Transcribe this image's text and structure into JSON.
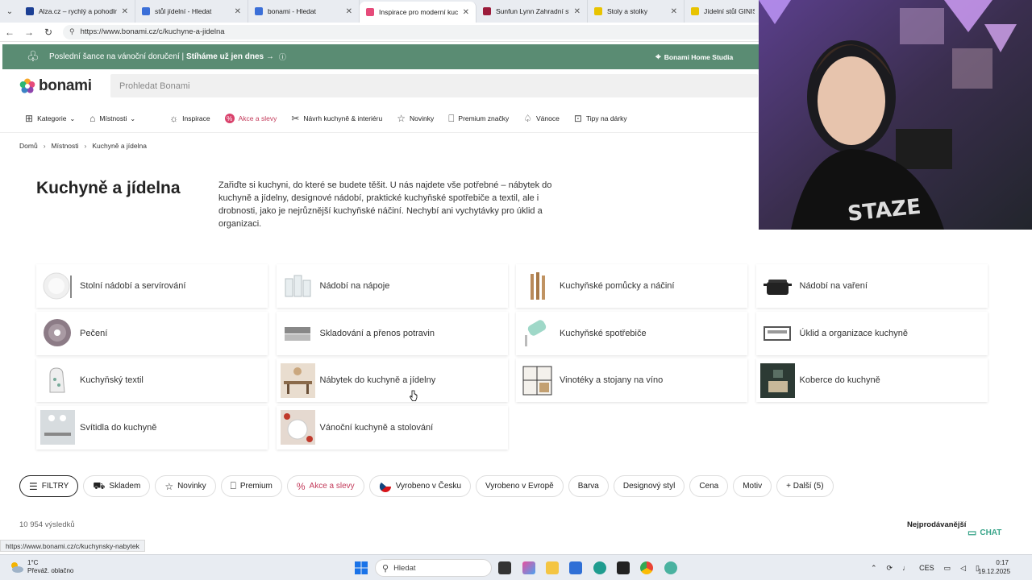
{
  "browser": {
    "tabs": [
      {
        "title": "Alza.cz – rychlý a pohodlný ná",
        "icon": "alza-favicon",
        "color": "#1c3f94"
      },
      {
        "title": "stůl jídelní - Hledat",
        "icon": "search-favicon",
        "color": "#3b6fd8"
      },
      {
        "title": "bonami - Hledat",
        "icon": "search-favicon",
        "color": "#3b6fd8"
      },
      {
        "title": "Inspirace pro moderní kuchy",
        "icon": "bonami-favicon",
        "color": "#e64b7a"
      },
      {
        "title": "Sunfun Lynn Zahradní stůl | B",
        "icon": "sunfun-favicon",
        "color": "#9b1b3a"
      },
      {
        "title": "Stoly a stolky",
        "icon": "sconto-favicon",
        "color": "#e8c300"
      },
      {
        "title": "Jídelní stůl GINISA",
        "icon": "sconto-favicon",
        "color": "#e8c300"
      }
    ],
    "active_tab": 3,
    "url": "https://www.bonami.cz/c/kuchyne-a-jidelna",
    "status_url": "https://www.bonami.cz/c/kuchynsky-nabytek"
  },
  "banner": {
    "text": "Poslední šance na vánoční doručení | ",
    "bold": "Stíháme už jen dnes →",
    "studio": "Bonami Home Studia"
  },
  "header": {
    "logo": "bonami",
    "search_placeholder": "Prohledat Bonami"
  },
  "menu": [
    {
      "label": "Kategorie",
      "icon": "grid-icon",
      "dropdown": true
    },
    {
      "label": "Místnosti",
      "icon": "house-icon",
      "dropdown": true
    },
    {
      "label": "Inspirace",
      "icon": "bulb-icon"
    },
    {
      "label": "Akce a slevy",
      "icon": "percent-icon",
      "sale": true
    },
    {
      "label": "Návrh kuchyně & interiéru",
      "icon": "tools-icon"
    },
    {
      "label": "Novinky",
      "icon": "star-icon"
    },
    {
      "label": "Premium značky",
      "icon": "bookmark-icon"
    },
    {
      "label": "Vánoce",
      "icon": "bell-icon"
    },
    {
      "label": "Tipy na dárky",
      "icon": "gift-icon"
    }
  ],
  "breadcrumb": [
    "Domů",
    "Místnosti",
    "Kuchyně a jídelna"
  ],
  "page": {
    "title": "Kuchyně a jídelna",
    "intro": "Zařiďte si kuchyni, do které se budete těšit. U nás najdete vše potřebné – nábytek do kuchyně a jídelny, designové nádobí, praktické kuchyňské spotřebiče a textil, ale i drobnosti, jako je nejrůznější kuchyňské náčiní. Nechybí ani vychytávky pro úklid a organizaci."
  },
  "categories": [
    {
      "label": "Stolní nádobí a servírování",
      "thumb": "plate"
    },
    {
      "label": "Nádobí na nápoje",
      "thumb": "glasses"
    },
    {
      "label": "Kuchyňské pomůcky a náčiní",
      "thumb": "utensils"
    },
    {
      "label": "Nádobí na vaření",
      "thumb": "pot"
    },
    {
      "label": "Pečení",
      "thumb": "bundt"
    },
    {
      "label": "Skladování a přenos potravin",
      "thumb": "container"
    },
    {
      "label": "Kuchyňské spotřebiče",
      "thumb": "mixer"
    },
    {
      "label": "Úklid a organizace kuchyně",
      "thumb": "rack"
    },
    {
      "label": "Kuchyňský textil",
      "thumb": "mitt"
    },
    {
      "label": "Nábytek do kuchyně a jídelny",
      "thumb": "dining"
    },
    {
      "label": "Vinotéky a stojany na víno",
      "thumb": "wine"
    },
    {
      "label": "Koberce do kuchyně",
      "thumb": "rug"
    },
    {
      "label": "Svítidla do kuchyně",
      "thumb": "lamp"
    },
    {
      "label": "Vánoční kuchyně a stolování",
      "thumb": "xmas"
    }
  ],
  "filters": [
    {
      "label": "FILTRY",
      "icon": "sliders-icon",
      "dark": true
    },
    {
      "label": "Skladem",
      "icon": "truck-icon"
    },
    {
      "label": "Novinky",
      "icon": "star-icon"
    },
    {
      "label": "Premium",
      "icon": "bookmark-icon"
    },
    {
      "label": "Akce a slevy",
      "icon": "percent-icon",
      "sale": true
    },
    {
      "label": "Vyrobeno v Česku",
      "icon": "czech-flag-icon"
    },
    {
      "label": "Vyrobeno v Evropě"
    },
    {
      "label": "Barva"
    },
    {
      "label": "Designový styl"
    },
    {
      "label": "Cena"
    },
    {
      "label": "Motiv"
    },
    {
      "label": "+ Další (5)"
    }
  ],
  "results": "10 954 výsledků",
  "sort": "Nejprodávanější",
  "chat": "CHAT",
  "taskbar": {
    "temp": "1°C",
    "weather": "Převáž. oblačno",
    "search": "Hledat",
    "lang": "CES",
    "time": "0:17",
    "date": "19.12.2025"
  }
}
